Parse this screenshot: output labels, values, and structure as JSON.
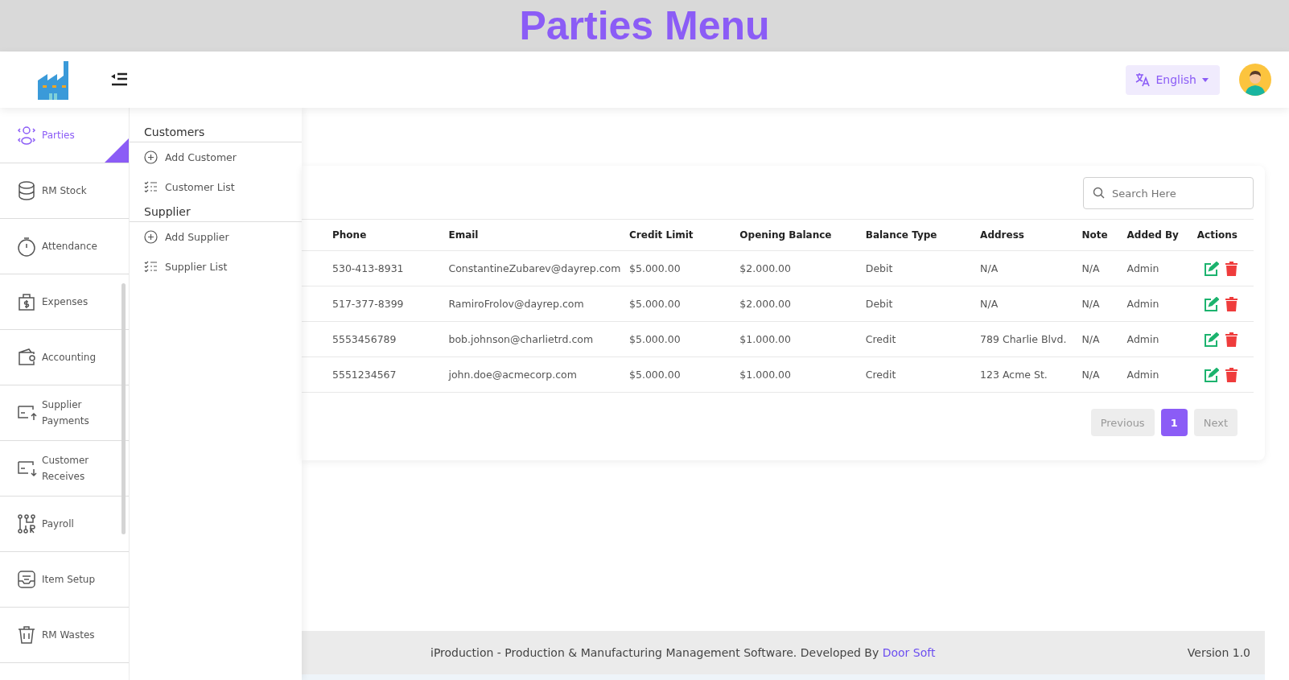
{
  "banner": {
    "title": "Parties Menu"
  },
  "header": {
    "language": "English"
  },
  "sidebar": {
    "items": [
      {
        "label": "Parties",
        "kind": "users",
        "selected": true
      },
      {
        "label": "RM Stock",
        "kind": "database",
        "selected": false
      },
      {
        "label": "Attendance",
        "kind": "timer",
        "selected": false
      },
      {
        "label": "Expenses",
        "kind": "money",
        "selected": false
      },
      {
        "label": "Accounting",
        "kind": "wallet",
        "selected": false
      },
      {
        "label": "Supplier Payments",
        "kind": "payup",
        "selected": false
      },
      {
        "label": "Customer Receives",
        "kind": "paydown",
        "selected": false
      },
      {
        "label": "Payroll",
        "kind": "payroll",
        "selected": false
      },
      {
        "label": "Item Setup",
        "kind": "inbox",
        "selected": false
      },
      {
        "label": "RM Wastes",
        "kind": "trash",
        "selected": false
      }
    ]
  },
  "submenu": {
    "groups": [
      {
        "title": "Customers",
        "items": [
          {
            "label": "Add Customer",
            "kind": "add"
          },
          {
            "label": "Customer List",
            "kind": "list"
          }
        ]
      },
      {
        "title": "Supplier",
        "items": [
          {
            "label": "Add Supplier",
            "kind": "add"
          },
          {
            "label": "Supplier List",
            "kind": "list"
          }
        ]
      }
    ]
  },
  "search": {
    "placeholder": "Search Here"
  },
  "table": {
    "columns": [
      "Phone",
      "Email",
      "Credit Limit",
      "Opening Balance",
      "Balance Type",
      "Address",
      "Note",
      "Added By",
      "Actions"
    ],
    "rows": [
      [
        "530-413-8931",
        "ConstantineZubarev@dayrep.com",
        "$5.000.00",
        "$2.000.00",
        "Debit",
        "N/A",
        "N/A",
        "Admin"
      ],
      [
        "517-377-8399",
        "RamiroFrolov@dayrep.com",
        "$5.000.00",
        "$2.000.00",
        "Debit",
        "N/A",
        "N/A",
        "Admin"
      ],
      [
        "5553456789",
        "bob.johnson@charlietrd.com",
        "$5.000.00",
        "$1.000.00",
        "Credit",
        "789 Charlie Blvd.",
        "N/A",
        "Admin"
      ],
      [
        "5551234567",
        "john.doe@acmecorp.com",
        "$5.000.00",
        "$1.000.00",
        "Credit",
        "123 Acme St.",
        "N/A",
        "Admin"
      ]
    ]
  },
  "pagination": {
    "previous": {
      "label": "Previous",
      "disabled": true
    },
    "pages": [
      {
        "label": "1",
        "selected": true
      }
    ],
    "next": {
      "label": "Next",
      "disabled": true
    }
  },
  "footer": {
    "text": "iProduction - Production & Manufacturing Management Software. Developed By",
    "link": "Door Soft",
    "version": "Version 1.0"
  }
}
